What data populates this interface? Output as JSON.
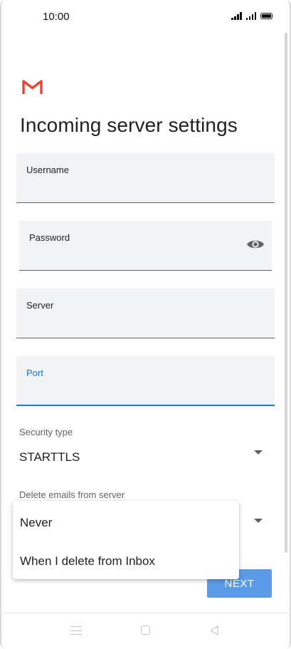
{
  "status_bar": {
    "time": "10:00"
  },
  "header": {
    "logo_icon": "gmail-icon",
    "title": "Incoming server settings"
  },
  "form": {
    "username": {
      "label": "Username",
      "value": ""
    },
    "password": {
      "label": "Password",
      "value": "",
      "toggle_icon": "eye-icon"
    },
    "server": {
      "label": "Server",
      "value": ""
    },
    "port": {
      "label": "Port",
      "value": "",
      "focused": true
    },
    "security_type": {
      "label": "Security type",
      "value": "STARTTLS"
    },
    "delete_emails": {
      "label": "Delete emails from server",
      "options": [
        "Never",
        "When I delete from Inbox"
      ]
    }
  },
  "actions": {
    "next_label": "NEXT"
  },
  "colors": {
    "accent": "#1a73e8",
    "button": "#5c9be8",
    "gmail_red": "#ea4335",
    "field_bg": "#f1f3f4"
  }
}
